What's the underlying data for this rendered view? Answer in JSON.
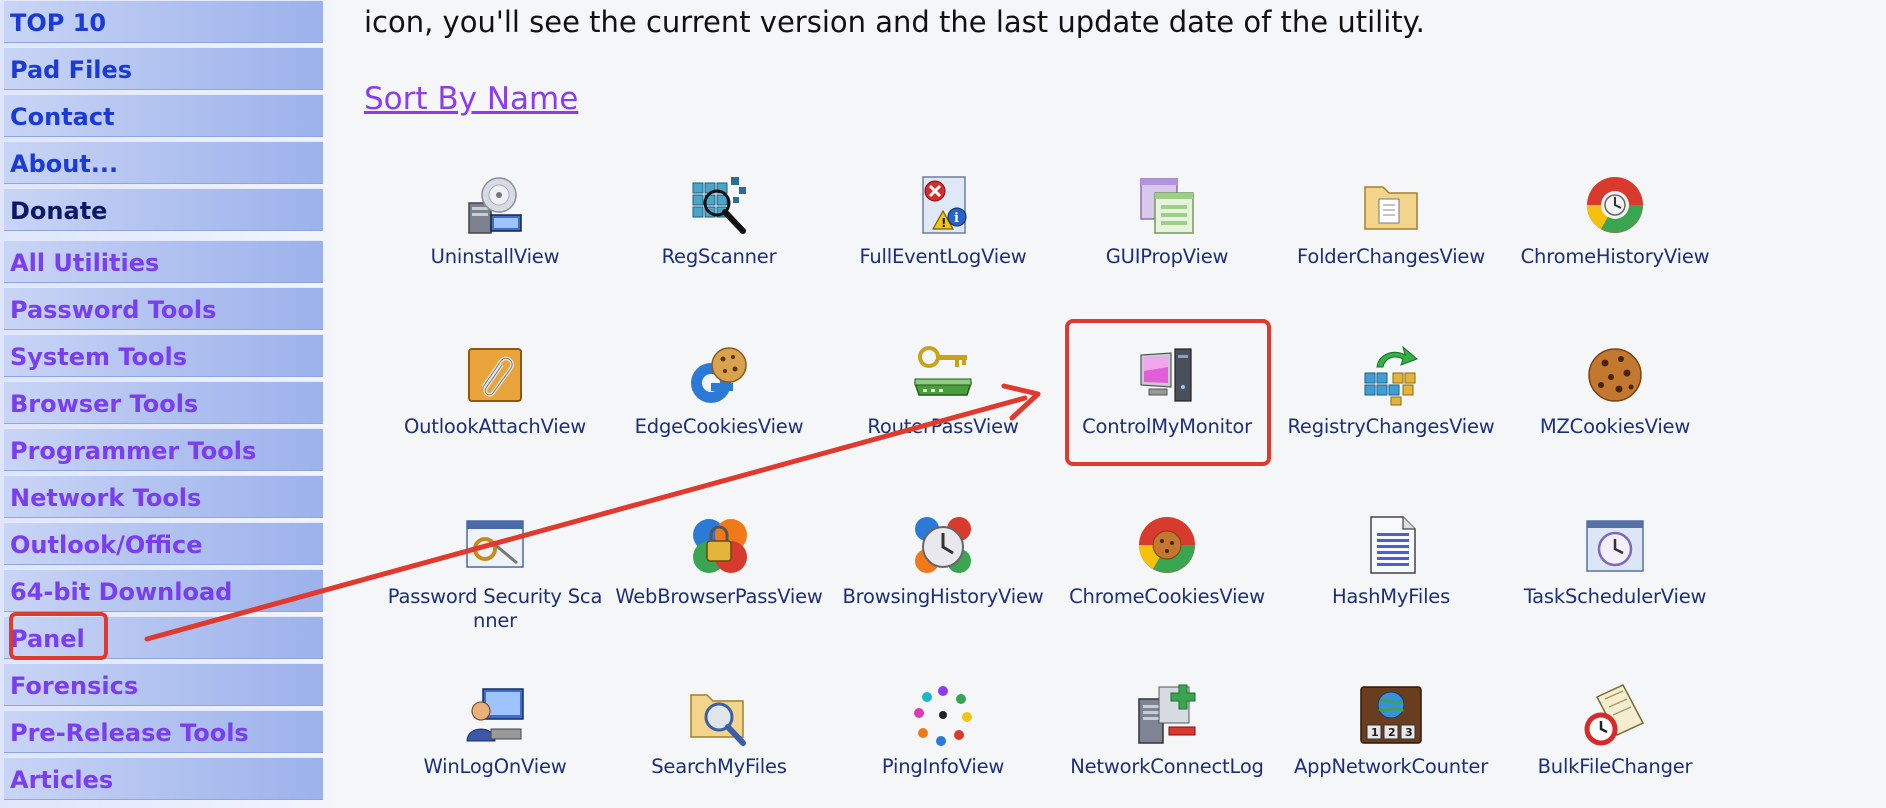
{
  "sidebar": {
    "items": [
      {
        "label": "TOP 10",
        "style": "blue"
      },
      {
        "label": "Pad Files",
        "style": "blue"
      },
      {
        "label": "Contact",
        "style": "blue"
      },
      {
        "label": "About...",
        "style": "blue"
      },
      {
        "label": "Donate",
        "style": "dark"
      },
      {
        "label": "All Utilities",
        "style": "purple"
      },
      {
        "label": "Password Tools",
        "style": "purple"
      },
      {
        "label": "System Tools",
        "style": "purple"
      },
      {
        "label": "Browser Tools",
        "style": "purple"
      },
      {
        "label": "Programmer Tools",
        "style": "purple"
      },
      {
        "label": "Network Tools",
        "style": "purple"
      },
      {
        "label": "Outlook/Office",
        "style": "purple"
      },
      {
        "label": "64-bit Download",
        "style": "purple"
      },
      {
        "label": "Panel",
        "style": "purple"
      },
      {
        "label": "Forensics",
        "style": "purple"
      },
      {
        "label": "Pre-Release Tools",
        "style": "purple"
      },
      {
        "label": "Articles",
        "style": "purple"
      }
    ]
  },
  "main": {
    "intro_text": "icon, you'll see the current version and the last update date of the utility.",
    "sort_link": "Sort By Name",
    "utilities": [
      {
        "name": "UninstallView",
        "icon": "cd-computer-icon"
      },
      {
        "name": "RegScanner",
        "icon": "registry-scan-icon"
      },
      {
        "name": "FullEventLogView",
        "icon": "event-log-icon"
      },
      {
        "name": "GUIPropView",
        "icon": "gui-windows-icon"
      },
      {
        "name": "FolderChangesView",
        "icon": "folder-icon"
      },
      {
        "name": "ChromeHistoryView",
        "icon": "chrome-history-icon"
      },
      {
        "name": "OutlookAttachView",
        "icon": "paperclip-icon"
      },
      {
        "name": "EdgeCookiesView",
        "icon": "edge-cookie-icon"
      },
      {
        "name": "RouterPassView",
        "icon": "router-key-icon"
      },
      {
        "name": "ControlMyMonitor",
        "icon": "monitor-icon"
      },
      {
        "name": "RegistryChangesView",
        "icon": "registry-changes-icon"
      },
      {
        "name": "MZCookiesView",
        "icon": "cookie-icon"
      },
      {
        "name": "Password Security Scanner",
        "icon": "password-scanner-icon"
      },
      {
        "name": "WebBrowserPassView",
        "icon": "browser-pass-icon"
      },
      {
        "name": "BrowsingHistoryView",
        "icon": "browsing-history-icon"
      },
      {
        "name": "ChromeCookiesView",
        "icon": "chrome-cookie-icon"
      },
      {
        "name": "HashMyFiles",
        "icon": "document-icon"
      },
      {
        "name": "TaskSchedulerView",
        "icon": "clock-icon"
      },
      {
        "name": "WinLogOnView",
        "icon": "user-computer-icon"
      },
      {
        "name": "SearchMyFiles",
        "icon": "search-folder-icon"
      },
      {
        "name": "PingInfoView",
        "icon": "dots-ring-icon"
      },
      {
        "name": "NetworkConnectLog",
        "icon": "network-connect-icon"
      },
      {
        "name": "AppNetworkCounter",
        "icon": "app-counter-icon"
      },
      {
        "name": "BulkFileChanger",
        "icon": "file-clock-icon"
      }
    ]
  },
  "colors": {
    "annotation": "#e03a2f",
    "nav_blue": "#1a3bd6",
    "nav_purple": "#7a3df0",
    "link": "#8a3cf0"
  }
}
